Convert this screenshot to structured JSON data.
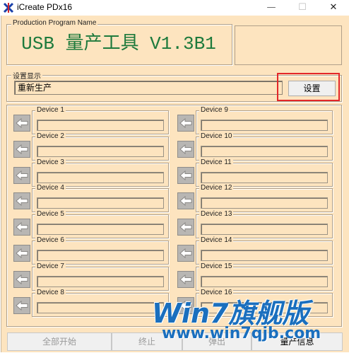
{
  "window": {
    "title": "iCreate PDx16",
    "minimize_glyph": "—",
    "maximize_glyph": "☐",
    "close_glyph": "✕"
  },
  "program_group": {
    "label": "Production Program Name",
    "value": "USB 量产工具 V1.3B1"
  },
  "settings_group": {
    "label": "设置显示",
    "value": "重新生产",
    "button_label": "设置"
  },
  "devices": [
    "Device 1",
    "Device 2",
    "Device 3",
    "Device 4",
    "Device 5",
    "Device 6",
    "Device 7",
    "Device 8",
    "Device 9",
    "Device 10",
    "Device 11",
    "Device 12",
    "Device 13",
    "Device 14",
    "Device 15",
    "Device 16"
  ],
  "bottom_buttons": [
    "全部开始",
    "终止",
    "弹出",
    "量产信息"
  ],
  "watermark": {
    "brand": "Win7旗舰版",
    "url": "www.win7qjb.com"
  },
  "colors": {
    "panel_bg": "#fde4bf",
    "banner_text": "#1d7a3c",
    "highlight": "#e3272a",
    "watermark": "#1a6fbe"
  }
}
